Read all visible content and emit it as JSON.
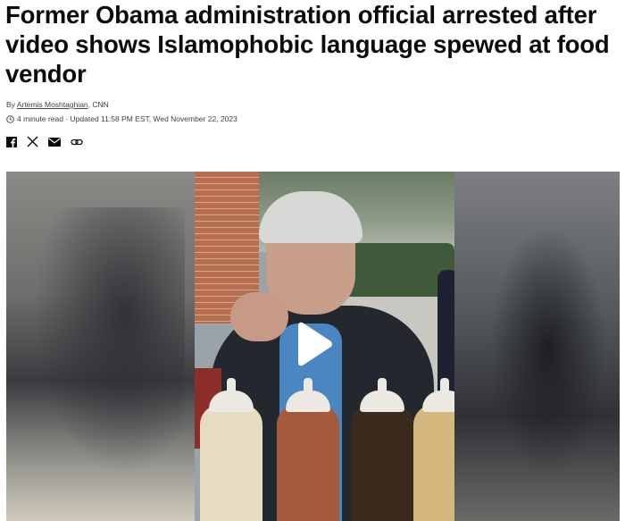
{
  "article": {
    "headline": "Former Obama administration official arrested after video shows Islamophobic language spewed at food vendor",
    "byline_prefix": "By ",
    "author": "Artemis Moshtaghian",
    "byline_suffix": ", CNN",
    "read_time": "4 minute read",
    "separator": " · ",
    "updated": "Updated 11:58 PM EST, Wed November 22, 2023"
  },
  "share": {
    "icons": [
      "facebook-icon",
      "x-icon",
      "email-icon",
      "link-icon"
    ]
  },
  "video": {
    "play_icon": "play-icon"
  },
  "colors": {
    "text": "#0c0c0c",
    "meta_text": "#404040",
    "play_button": "#ffffff"
  }
}
